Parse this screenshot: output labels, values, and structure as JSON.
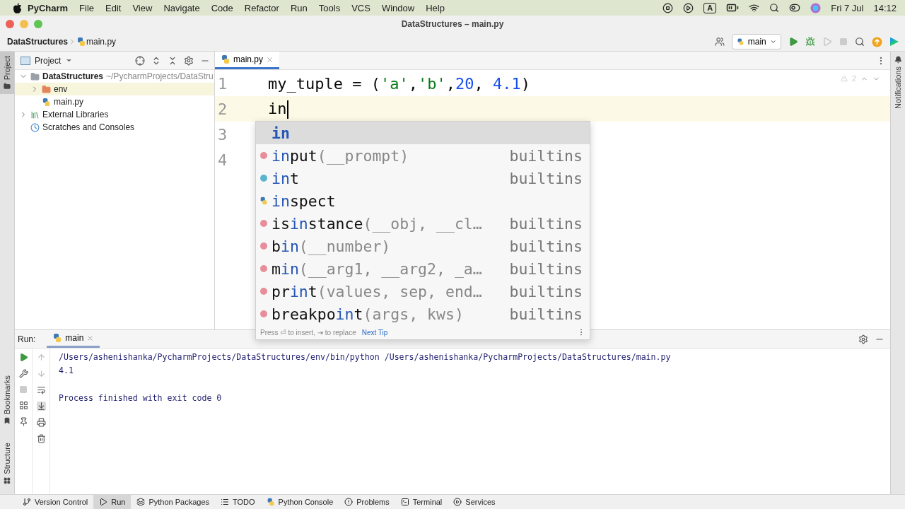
{
  "menu_bar": {
    "app": "PyCharm",
    "items": [
      "File",
      "Edit",
      "View",
      "Navigate",
      "Code",
      "Refactor",
      "Run",
      "Tools",
      "VCS",
      "Window",
      "Help"
    ],
    "input_source": "A",
    "date": "Fri 7 Jul",
    "time": "14:12"
  },
  "window": {
    "title": "DataStructures – main.py"
  },
  "breadcrumb": [
    "DataStructures",
    "main.py"
  ],
  "run_config": {
    "label": "main"
  },
  "left_stripe": [
    {
      "label": "Project",
      "selected": true
    },
    {
      "label": "Bookmarks",
      "selected": false
    },
    {
      "label": "Structure",
      "selected": false
    }
  ],
  "right_stripe": [
    {
      "label": "Notifications"
    }
  ],
  "project_panel": {
    "title": "Project",
    "tree": [
      {
        "label": "DataStructures",
        "path": "~/PycharmProjects/DataStru",
        "kind": "project",
        "expanded": true,
        "selected": false,
        "children": [
          {
            "label": "env",
            "kind": "folder",
            "expanded": false,
            "selected": true
          },
          {
            "label": "main.py",
            "kind": "file",
            "selected": false
          }
        ]
      },
      {
        "label": "External Libraries",
        "kind": "library",
        "expanded": false,
        "selected": false
      },
      {
        "label": "Scratches and Consoles",
        "kind": "scratches",
        "selected": false
      }
    ]
  },
  "editor": {
    "tabs": [
      {
        "label": "main.py",
        "selected": true
      }
    ],
    "inspections": "2",
    "lines": [
      {
        "number": "1",
        "current": false,
        "tokens": [
          {
            "text": "my_tuple = (",
            "kind": "plain"
          },
          {
            "text": "'a'",
            "kind": "string"
          },
          {
            "text": ",",
            "kind": "plain"
          },
          {
            "text": "'b'",
            "kind": "string"
          },
          {
            "text": ",",
            "kind": "plain"
          },
          {
            "text": "20",
            "kind": "number"
          },
          {
            "text": ", ",
            "kind": "plain"
          },
          {
            "text": "4.1",
            "kind": "number"
          },
          {
            "text": ")",
            "kind": "plain"
          }
        ]
      },
      {
        "number": "2",
        "current": true,
        "tokens": [
          {
            "text": "in",
            "kind": "plain"
          }
        ]
      },
      {
        "number": "3",
        "current": false
      },
      {
        "number": "4",
        "current": false
      }
    ]
  },
  "completion": {
    "items": [
      {
        "kind": "keyword",
        "match": "in",
        "selected": true
      },
      {
        "kind": "function",
        "match": "in",
        "post": "put",
        "params": "(__prompt)",
        "source": "builtins",
        "selected": false
      },
      {
        "kind": "class",
        "match": "in",
        "post": "t",
        "source": "builtins",
        "selected": false
      },
      {
        "kind": "module",
        "match": "in",
        "post": "spect",
        "selected": false
      },
      {
        "kind": "function",
        "pre": "is",
        "match": "in",
        "post": "stance",
        "params": "(__obj, __cl…",
        "source": "builtins",
        "selected": false
      },
      {
        "kind": "function",
        "pre": "b",
        "match": "in",
        "params": "(__number)",
        "source": "builtins",
        "selected": false
      },
      {
        "kind": "function",
        "pre": "m",
        "match": "in",
        "params": "(__arg1, __arg2, _a…",
        "source": "builtins",
        "selected": false
      },
      {
        "kind": "function",
        "pre": "pr",
        "match": "in",
        "post": "t",
        "params": "(values, sep, end…",
        "source": "builtins",
        "selected": false
      },
      {
        "kind": "function",
        "pre": "breakpo",
        "match": "in",
        "post": "t",
        "params": "(args, kws)",
        "source": "builtins",
        "selected": false
      }
    ],
    "hint": "Press ⏎ to insert, ⇥ to replace",
    "link": "Next Tip"
  },
  "run_panel": {
    "title": "Run:",
    "tabs": [
      {
        "label": "main",
        "selected": true
      }
    ],
    "output": [
      "/Users/ashenishanka/PycharmProjects/DataStructures/env/bin/python /Users/ashenishanka/PycharmProjects/DataStructures/main.py",
      "4.1"
    ],
    "exit_message": "Process finished with exit code 0"
  },
  "status_bar": [
    {
      "label": "Version Control",
      "selected": false
    },
    {
      "label": "Run",
      "selected": true
    },
    {
      "label": "Python Packages",
      "selected": false
    },
    {
      "label": "TODO",
      "selected": false
    },
    {
      "label": "Python Console",
      "selected": false
    },
    {
      "label": "Problems",
      "selected": false
    },
    {
      "label": "Terminal",
      "selected": false
    },
    {
      "label": "Services",
      "selected": false
    }
  ]
}
